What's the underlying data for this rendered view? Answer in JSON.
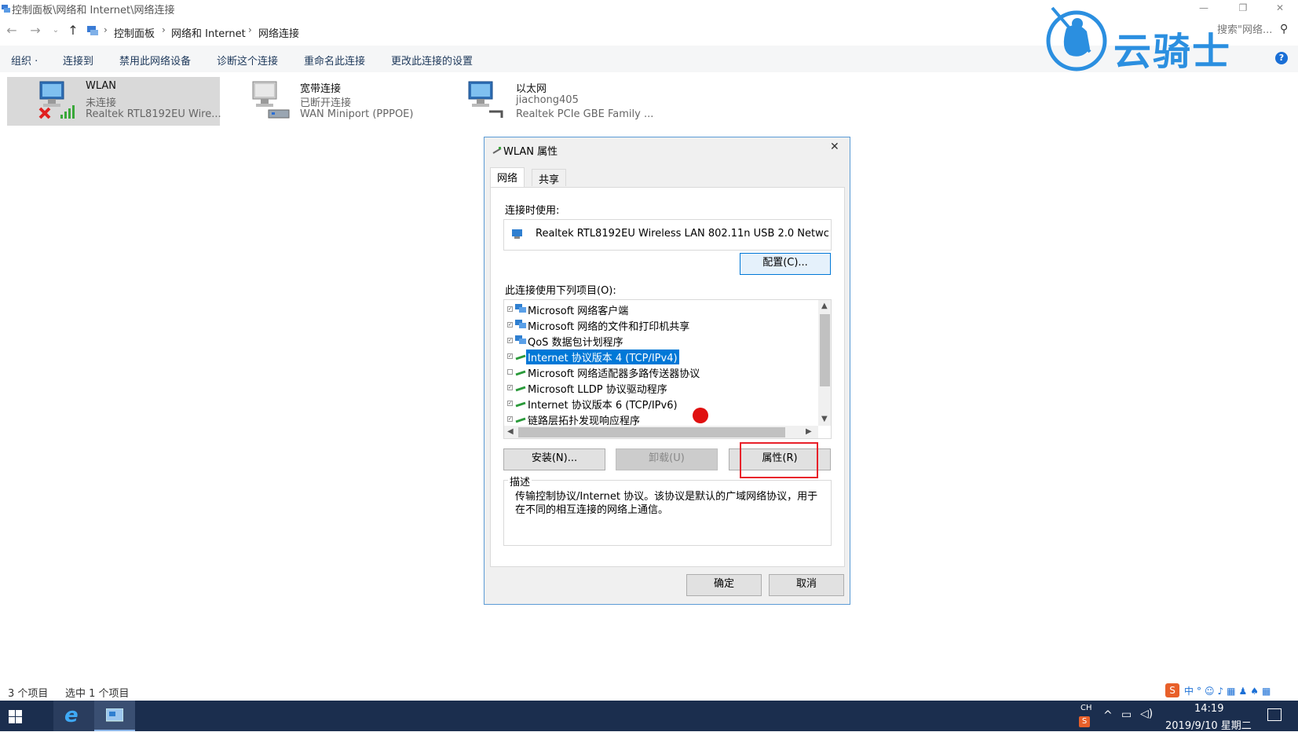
{
  "window": {
    "title": "控制面板\\网络和 Internet\\网络连接",
    "controls": [
      "—",
      "❐",
      "✕"
    ]
  },
  "address": {
    "breadcrumbs": [
      "控制面板",
      "网络和 Internet",
      "网络连接"
    ],
    "search_placeholder": "搜索\"网络..."
  },
  "toolbar": {
    "items": [
      "组织 ·",
      "连接到",
      "禁用此网络设备",
      "诊断这个连接",
      "重命名此连接",
      "更改此连接的设置"
    ]
  },
  "connections": [
    {
      "name": "WLAN",
      "status": "未连接",
      "device": "Realtek RTL8192EU Wire...",
      "selected": true
    },
    {
      "name": "宽带连接",
      "status": "已断开连接",
      "device": "WAN Miniport (PPPOE)",
      "selected": false
    },
    {
      "name": "以太网",
      "status": "jiachong405",
      "device": "Realtek PCIe GBE Family ...",
      "selected": false
    }
  ],
  "dialog": {
    "title": "WLAN 属性",
    "tabs": [
      "网络",
      "共享"
    ],
    "connect_using_label": "连接时使用:",
    "adapter": "Realtek RTL8192EU Wireless LAN 802.11n USB 2.0 Netwc",
    "configure_button": "配置(C)...",
    "items_label": "此连接使用下列项目(O):",
    "items": [
      {
        "text": "Microsoft 网络客户端",
        "checked": true,
        "icon": "network-client-icon"
      },
      {
        "text": "Microsoft 网络的文件和打印机共享",
        "checked": true,
        "icon": "network-client-icon"
      },
      {
        "text": "QoS 数据包计划程序",
        "checked": true,
        "icon": "network-client-icon"
      },
      {
        "text": "Internet 协议版本 4 (TCP/IPv4)",
        "checked": true,
        "icon": "protocol-icon",
        "selected": true
      },
      {
        "text": "Microsoft 网络适配器多路传送器协议",
        "checked": false,
        "icon": "protocol-icon"
      },
      {
        "text": "Microsoft LLDP 协议驱动程序",
        "checked": true,
        "icon": "protocol-icon"
      },
      {
        "text": "Internet 协议版本 6 (TCP/IPv6)",
        "checked": true,
        "icon": "protocol-icon"
      },
      {
        "text": "链路层拓扑发现响应程序",
        "checked": true,
        "icon": "protocol-icon"
      }
    ],
    "install_button": "安装(N)...",
    "uninstall_button": "卸载(U)",
    "properties_button": "属性(R)",
    "description_label": "描述",
    "description": "传输控制协议/Internet 协议。该协议是默认的广域网络协议，用于在不同的相互连接的网络上通信。",
    "ok_button": "确定",
    "cancel_button": "取消"
  },
  "watermark": {
    "text": "云骑士"
  },
  "status": {
    "item_count": "3 个项目",
    "selected_count": "选中 1 个项目"
  },
  "taskbar": {
    "lang": "CH",
    "time": "14:19",
    "date": "2019/9/10 星期二"
  },
  "colors": {
    "accent": "#0078d7",
    "highlight_box": "#e8202a",
    "taskbar": "#1b2e4e",
    "watermark": "#2b8fe0"
  }
}
